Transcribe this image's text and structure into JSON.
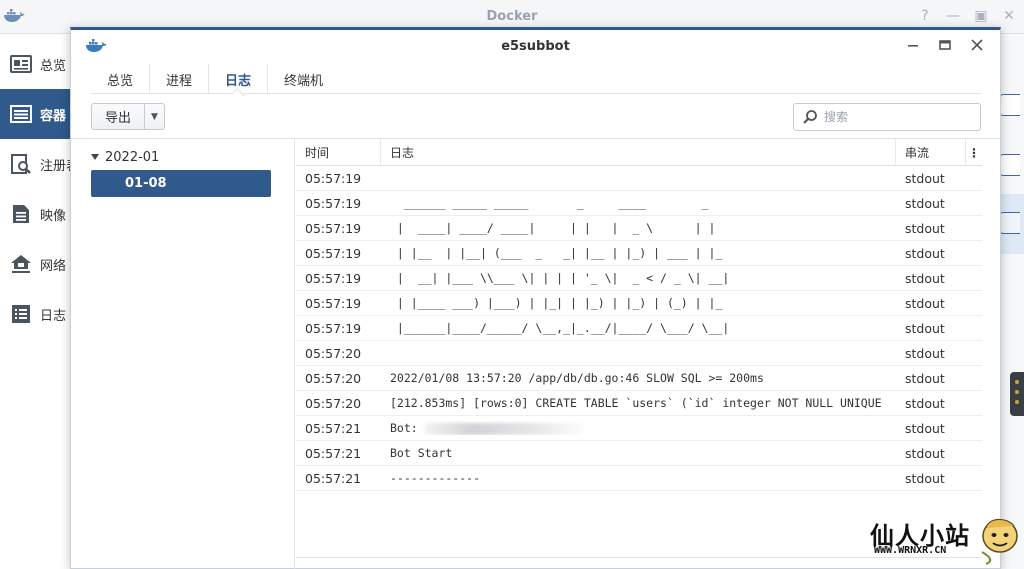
{
  "outer": {
    "title": "Docker",
    "sidebar": [
      {
        "label": "总览",
        "icon": "overview-icon"
      },
      {
        "label": "容器",
        "icon": "container-icon",
        "active": true
      },
      {
        "label": "注册表",
        "icon": "registry-icon"
      },
      {
        "label": "映像",
        "icon": "image-icon"
      },
      {
        "label": "网络",
        "icon": "network-icon"
      },
      {
        "label": "日志",
        "icon": "log-icon"
      }
    ]
  },
  "dialog": {
    "title": "e5subbot",
    "tabs": [
      "总览",
      "进程",
      "日志",
      "终端机"
    ],
    "active_tab": "日志",
    "export_label": "导出",
    "search_placeholder": "搜索",
    "tree": {
      "group": "2022-01",
      "item": "01-08"
    },
    "columns": {
      "time": "时间",
      "log": "日志",
      "stream": "串流",
      "menu": "⋮"
    },
    "rows": [
      {
        "time": "05:57:19",
        "log": "",
        "stream": "stdout"
      },
      {
        "time": "05:57:19",
        "log": "  ______ _____ _____       _     ____        _",
        "stream": "stdout"
      },
      {
        "time": "05:57:19",
        "log": " |  ____| ____/ ____|     | |   |  _ \\      | |",
        "stream": "stdout"
      },
      {
        "time": "05:57:19",
        "log": " | |__  | |__| (___  _   _| |__ | |_) | ___ | |_",
        "stream": "stdout"
      },
      {
        "time": "05:57:19",
        "log": " |  __| |___ \\\\___ \\| | | | '_ \\|  _ < / _ \\| __|",
        "stream": "stdout"
      },
      {
        "time": "05:57:19",
        "log": " | |____ ___) |___) | |_| | |_) | |_) | (_) | |_",
        "stream": "stdout"
      },
      {
        "time": "05:57:19",
        "log": " |______|____/_____/ \\__,_|_.__/|____/ \\___/ \\__|",
        "stream": "stdout"
      },
      {
        "time": "05:57:20",
        "log": "",
        "stream": "stdout"
      },
      {
        "time": "05:57:20",
        "log": "2022/01/08 13:57:20 /app/db/db.go:46 SLOW SQL >= 200ms",
        "stream": "stdout"
      },
      {
        "time": "05:57:20",
        "log": "[212.853ms] [rows:0] CREATE TABLE `users` (`id` integer NOT NULL UNIQUE",
        "stream": "stdout"
      },
      {
        "time": "05:57:21",
        "log": "Bot:",
        "stream": "stdout",
        "redacted": true
      },
      {
        "time": "05:57:21",
        "log": "Bot Start",
        "stream": "stdout"
      },
      {
        "time": "05:57:21",
        "log": "-------------",
        "stream": "stdout"
      }
    ]
  },
  "watermark": {
    "text": "仙人小站",
    "url": "WWW.WRNXR.CN"
  },
  "colors": {
    "accent": "#2f5a8b",
    "border": "#dfe3e8"
  }
}
